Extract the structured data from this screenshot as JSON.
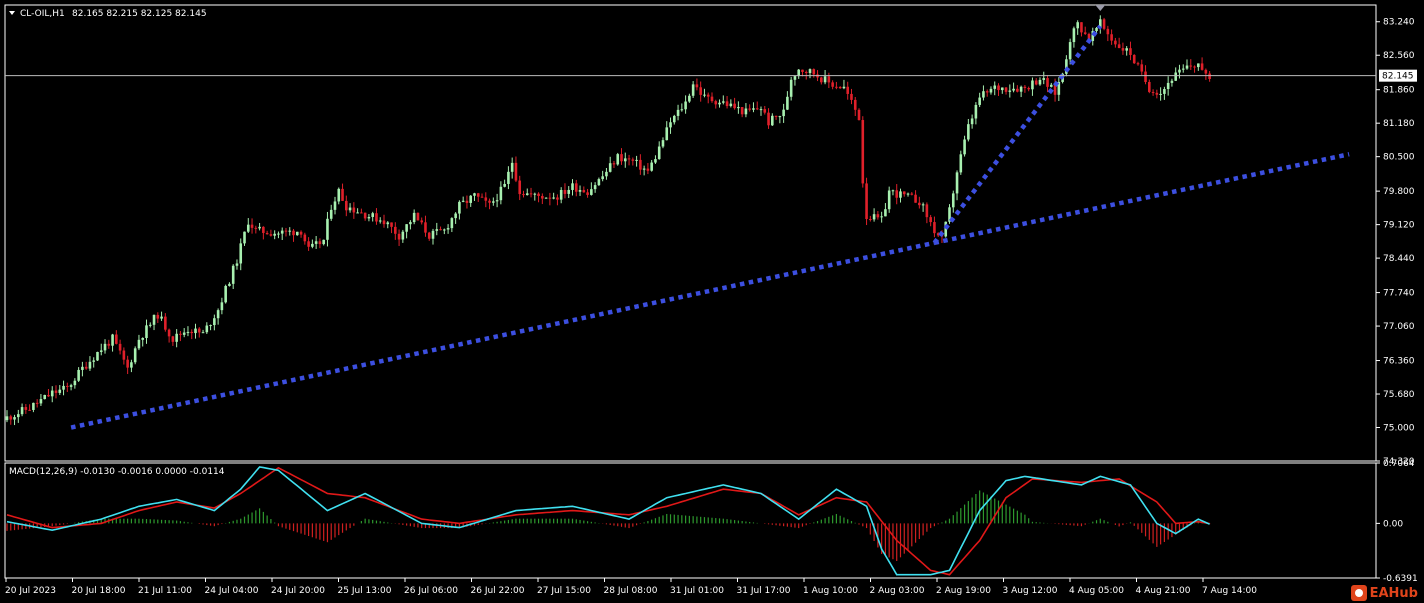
{
  "header": {
    "symbol_label": "CL-OIL,H1",
    "ohlc_label": "82.165 82.215 82.125 82.145"
  },
  "macd": {
    "label": "MACD(12,26,9) -0.0130 -0.0016 0.0000 -0.0114"
  },
  "brand": {
    "text": "EAHub"
  },
  "colors": {
    "background": "#000000",
    "bull_candle": "#a8f0b0",
    "bear_candle": "#e0202a",
    "trendline": "#3c4fe0",
    "macd_line": "#40e0f0",
    "signal_line": "#e01818",
    "hist_up": "#2e9a2e",
    "hist_down": "#d02020",
    "frame": "#ffffff"
  },
  "chart_data": [
    {
      "type": "candlestick",
      "title": "CL-OIL,H1",
      "bid_price": "82.145",
      "ylim": [
        74.32,
        83.58
      ],
      "y_ticks": [
        "83.240",
        "82.560",
        "81.860",
        "81.180",
        "80.500",
        "79.800",
        "79.120",
        "78.440",
        "77.740",
        "77.060",
        "76.360",
        "75.680",
        "75.000",
        "74.320"
      ],
      "x_ticks": [
        "20 Jul 2023",
        "20 Jul 18:00",
        "21 Jul 11:00",
        "24 Jul 04:00",
        "24 Jul 20:00",
        "25 Jul 13:00",
        "26 Jul 06:00",
        "26 Jul 22:00",
        "27 Jul 15:00",
        "28 Jul 08:00",
        "31 Jul 01:00",
        "31 Jul 17:00",
        "1 Aug 10:00",
        "2 Aug 03:00",
        "2 Aug 19:00",
        "3 Aug 12:00",
        "4 Aug 05:00",
        "4 Aug 21:00",
        "7 Aug 14:00"
      ],
      "close_path": [
        [
          0,
          75.2
        ],
        [
          6,
          75.4
        ],
        [
          12,
          75.7
        ],
        [
          16,
          75.8
        ],
        [
          20,
          76.2
        ],
        [
          25,
          76.6
        ],
        [
          28,
          76.8
        ],
        [
          32,
          76.2
        ],
        [
          35,
          76.8
        ],
        [
          40,
          77.3
        ],
        [
          44,
          76.8
        ],
        [
          48,
          77.0
        ],
        [
          52,
          76.9
        ],
        [
          56,
          77.4
        ],
        [
          58,
          77.8
        ],
        [
          61,
          78.4
        ],
        [
          64,
          79.2
        ],
        [
          66,
          79.0
        ],
        [
          72,
          78.95
        ],
        [
          78,
          79.0
        ],
        [
          80,
          78.6
        ],
        [
          84,
          78.8
        ],
        [
          86,
          79.5
        ],
        [
          88,
          79.8
        ],
        [
          90,
          79.5
        ],
        [
          96,
          79.3
        ],
        [
          100,
          79.2
        ],
        [
          104,
          78.9
        ],
        [
          108,
          79.3
        ],
        [
          112,
          78.9
        ],
        [
          116,
          79.0
        ],
        [
          120,
          79.5
        ],
        [
          124,
          79.7
        ],
        [
          128,
          79.5
        ],
        [
          132,
          79.9
        ],
        [
          134,
          80.4
        ],
        [
          136,
          79.8
        ],
        [
          140,
          79.7
        ],
        [
          146,
          79.7
        ],
        [
          150,
          79.9
        ],
        [
          154,
          79.8
        ],
        [
          158,
          80.1
        ],
        [
          162,
          80.5
        ],
        [
          166,
          80.4
        ],
        [
          170,
          80.2
        ],
        [
          172,
          80.5
        ],
        [
          176,
          81.2
        ],
        [
          180,
          81.6
        ],
        [
          182,
          82.0
        ],
        [
          185,
          81.7
        ],
        [
          190,
          81.6
        ],
        [
          196,
          81.4
        ],
        [
          200,
          81.5
        ],
        [
          202,
          81.2
        ],
        [
          206,
          81.4
        ],
        [
          208,
          82.1
        ],
        [
          210,
          82.3
        ],
        [
          214,
          82.2
        ],
        [
          218,
          82.0
        ],
        [
          222,
          81.9
        ],
        [
          226,
          81.3
        ],
        [
          227,
          80.0
        ],
        [
          228,
          79.3
        ],
        [
          232,
          79.2
        ],
        [
          234,
          79.8
        ],
        [
          238,
          79.7
        ],
        [
          242,
          79.6
        ],
        [
          246,
          79.0
        ],
        [
          248,
          78.8
        ],
        [
          250,
          79.4
        ],
        [
          252,
          80.2
        ],
        [
          255,
          81.1
        ],
        [
          258,
          81.7
        ],
        [
          262,
          81.9
        ],
        [
          266,
          81.9
        ],
        [
          270,
          81.9
        ],
        [
          274,
          82.1
        ],
        [
          278,
          81.8
        ],
        [
          280,
          82.2
        ],
        [
          282,
          82.9
        ],
        [
          284,
          83.2
        ],
        [
          287,
          82.9
        ],
        [
          290,
          83.2
        ],
        [
          294,
          82.8
        ],
        [
          298,
          82.6
        ],
        [
          300,
          82.3
        ],
        [
          303,
          81.9
        ],
        [
          306,
          81.8
        ],
        [
          309,
          82.1
        ],
        [
          313,
          82.3
        ],
        [
          316,
          82.4
        ],
        [
          318,
          82.1
        ],
        [
          319,
          82.145
        ]
      ],
      "trendlines": [
        {
          "from": [
            17,
            75.0
          ],
          "to": [
            246,
            78.75
          ]
        },
        {
          "from": [
            246,
            78.75
          ],
          "to": [
            356,
            80.55
          ]
        },
        {
          "from": [
            246,
            78.75
          ],
          "to": [
            290,
            83.15
          ]
        }
      ],
      "marker": "down-triangle-top"
    },
    {
      "type": "macd",
      "title": "MACD(12,26,9) -0.0130 -0.0016 0.0000 -0.0114",
      "ylim": [
        -0.6391,
        0.7064
      ],
      "y_ticks": [
        "0.7064",
        "0.00",
        "-0.6391"
      ],
      "macd_path": [
        [
          0,
          0.02
        ],
        [
          12,
          -0.08
        ],
        [
          25,
          0.05
        ],
        [
          35,
          0.2
        ],
        [
          45,
          0.28
        ],
        [
          55,
          0.15
        ],
        [
          62,
          0.4
        ],
        [
          67,
          0.66
        ],
        [
          72,
          0.62
        ],
        [
          85,
          0.15
        ],
        [
          95,
          0.35
        ],
        [
          110,
          0.0
        ],
        [
          120,
          -0.05
        ],
        [
          135,
          0.15
        ],
        [
          150,
          0.2
        ],
        [
          165,
          0.05
        ],
        [
          175,
          0.3
        ],
        [
          190,
          0.45
        ],
        [
          200,
          0.35
        ],
        [
          210,
          0.05
        ],
        [
          220,
          0.4
        ],
        [
          228,
          0.2
        ],
        [
          232,
          -0.3
        ],
        [
          236,
          -0.6
        ],
        [
          245,
          -0.6
        ],
        [
          250,
          -0.55
        ],
        [
          258,
          0.15
        ],
        [
          265,
          0.5
        ],
        [
          270,
          0.55
        ],
        [
          285,
          0.45
        ],
        [
          290,
          0.55
        ],
        [
          298,
          0.45
        ],
        [
          305,
          0.0
        ],
        [
          310,
          -0.12
        ],
        [
          316,
          0.05
        ],
        [
          319,
          -0.01
        ]
      ],
      "signal_path": [
        [
          0,
          0.1
        ],
        [
          12,
          -0.05
        ],
        [
          25,
          0.0
        ],
        [
          35,
          0.15
        ],
        [
          45,
          0.25
        ],
        [
          55,
          0.18
        ],
        [
          62,
          0.35
        ],
        [
          72,
          0.65
        ],
        [
          85,
          0.35
        ],
        [
          95,
          0.3
        ],
        [
          110,
          0.05
        ],
        [
          120,
          0.0
        ],
        [
          135,
          0.1
        ],
        [
          150,
          0.15
        ],
        [
          165,
          0.1
        ],
        [
          175,
          0.2
        ],
        [
          190,
          0.4
        ],
        [
          200,
          0.35
        ],
        [
          210,
          0.1
        ],
        [
          220,
          0.3
        ],
        [
          228,
          0.25
        ],
        [
          236,
          -0.2
        ],
        [
          245,
          -0.55
        ],
        [
          250,
          -0.6
        ],
        [
          258,
          -0.2
        ],
        [
          265,
          0.3
        ],
        [
          272,
          0.52
        ],
        [
          285,
          0.48
        ],
        [
          295,
          0.52
        ],
        [
          305,
          0.25
        ],
        [
          310,
          0.0
        ],
        [
          316,
          0.02
        ],
        [
          319,
          -0.002
        ]
      ]
    }
  ]
}
